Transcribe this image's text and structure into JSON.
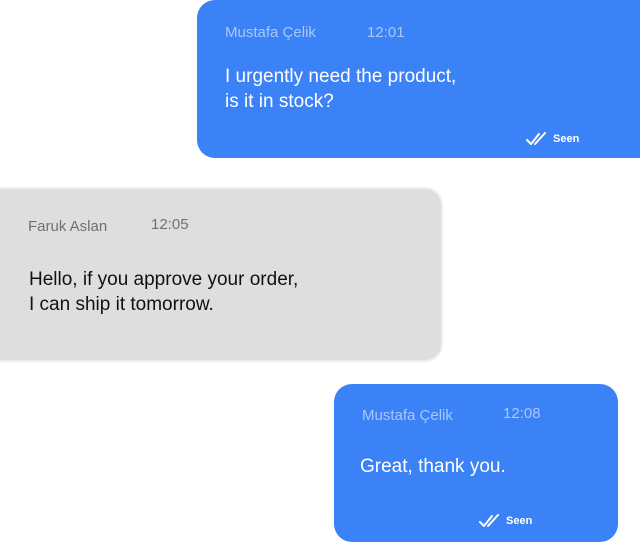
{
  "messages": [
    {
      "direction": "outgoing",
      "sender": "Mustafa Çelik",
      "time": "12:01",
      "text_line1": "I urgently need the product,",
      "text_line2": "is it in stock?",
      "status": "Seen",
      "status_icon": "double-check-icon"
    },
    {
      "direction": "incoming",
      "sender": "Faruk Aslan",
      "time": "12:05",
      "text_line1": "Hello, if you approve your order,",
      "text_line2": "I can ship it tomorrow."
    },
    {
      "direction": "outgoing",
      "sender": "Mustafa Çelik",
      "time": "12:08",
      "text_line1": "Great, thank you.",
      "status": "Seen",
      "status_icon": "double-check-icon"
    }
  ],
  "colors": {
    "outgoing_bubble": "#3b82f6",
    "incoming_bubble": "#dedede"
  }
}
